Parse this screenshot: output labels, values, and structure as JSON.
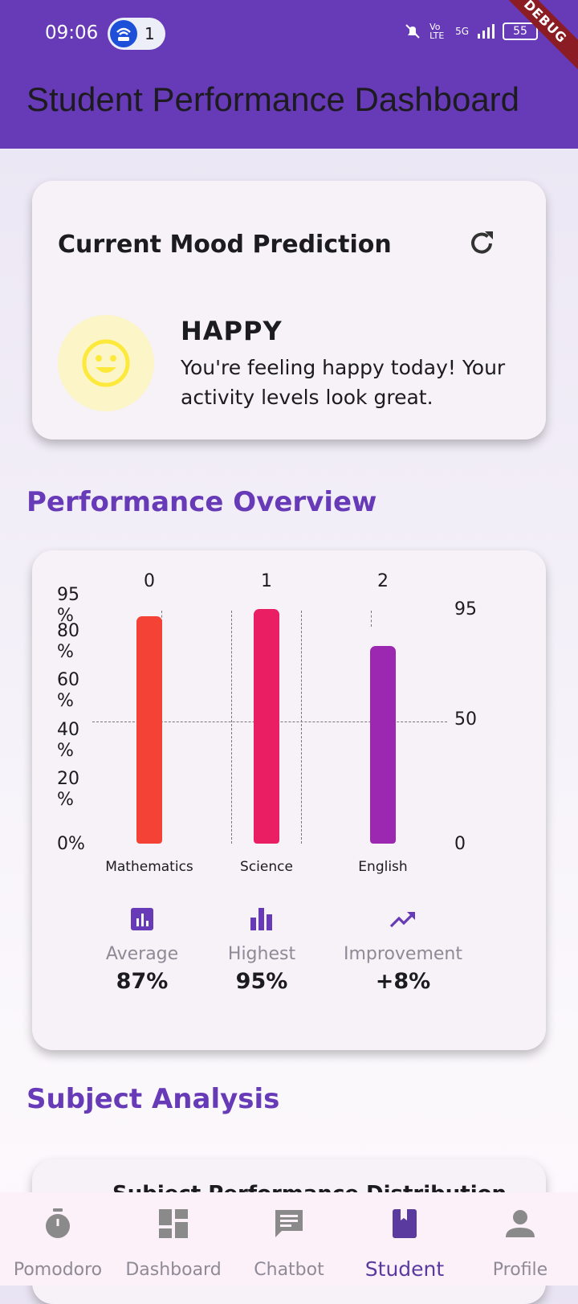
{
  "status_bar": {
    "time": "09:06",
    "hotspot_count": "1",
    "network": "5G",
    "volte": "Vo LTE",
    "battery": "55"
  },
  "debug_banner": "DEBUG",
  "app_bar": {
    "title": "Student Performance Dashboard"
  },
  "mood_card": {
    "title": "Current Mood Prediction",
    "refresh_icon": "refresh-icon",
    "mood_icon": "smiley-face-icon",
    "mood": "HAPPY",
    "message": "You're feeling happy today! Your activity levels look great."
  },
  "performance_section": {
    "title": "Performance Overview"
  },
  "chart_data": {
    "type": "bar",
    "categories": [
      "Mathematics",
      "Science",
      "English"
    ],
    "top_labels": [
      "0",
      "1",
      "2"
    ],
    "values": [
      92,
      95,
      80
    ],
    "bar_colors": [
      "#f44336",
      "#e91e63",
      "#9c27b0"
    ],
    "left_axis_ticks": [
      "95 %",
      "80 %",
      "60 %",
      "40 %",
      "20 %",
      "0%"
    ],
    "right_axis_ticks": [
      "95",
      "50",
      "0"
    ],
    "ylim": [
      0,
      95
    ],
    "grid": "dashed"
  },
  "stats": [
    {
      "icon": "bar-chart-icon",
      "label": "Average",
      "value": "87%"
    },
    {
      "icon": "equalizer-icon",
      "label": "Highest",
      "value": "95%"
    },
    {
      "icon": "trending-up-icon",
      "label": "Improvement",
      "value": "+8%"
    }
  ],
  "subject_section": {
    "title": "Subject Analysis",
    "card_title": "Subject Performance Distribution"
  },
  "bottom_nav": {
    "items": [
      {
        "label": "Pomodoro",
        "icon": "timer-icon",
        "active": false
      },
      {
        "label": "Dashboard",
        "icon": "dashboard-icon",
        "active": false
      },
      {
        "label": "Chatbot",
        "icon": "chat-icon",
        "active": false
      },
      {
        "label": "Student",
        "icon": "book-icon",
        "active": true
      },
      {
        "label": "Profile",
        "icon": "person-icon",
        "active": false
      }
    ]
  },
  "colors": {
    "primary": "#673ab7",
    "happy_yellow": "#ffeb3b",
    "nav_background": "#fcf1f9"
  }
}
